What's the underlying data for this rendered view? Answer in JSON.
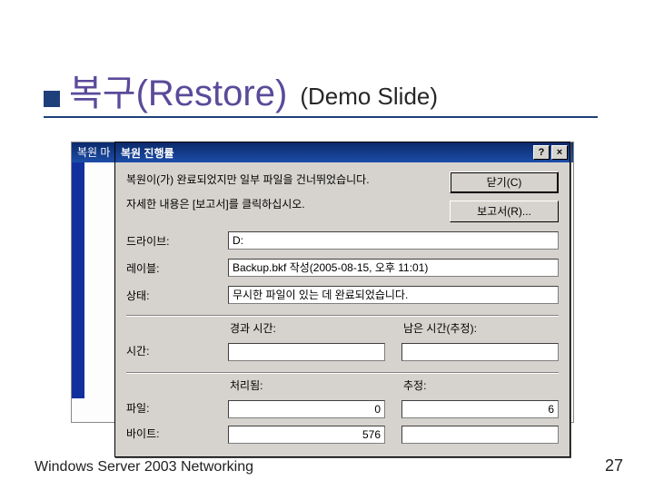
{
  "slide": {
    "title_main": "복구(Restore)",
    "title_sub": "(Demo Slide)",
    "footer_left": "Windows Server 2003 Networking",
    "page_number": "27"
  },
  "back_window": {
    "title": "복원 마"
  },
  "dialog": {
    "title": "복원 진행률",
    "help_btn": "?",
    "close_btn": "×",
    "msg1": "복원이(가) 완료되었지만 일부 파일을 건너뛰었습니다.",
    "msg2": "자세한 내용은 [보고서]를 클릭하십시오.",
    "btn_close": "닫기(C)",
    "btn_report": "보고서(R)...",
    "labels": {
      "drive": "드라이브:",
      "label": "레이블:",
      "status": "상태:",
      "time": "시간:",
      "files": "파일:",
      "bytes": "바이트:",
      "elapsed": "경과 시간:",
      "remaining": "남은 시간(추정):",
      "processed": "처리됨:",
      "estimated": "추정:"
    },
    "values": {
      "drive": "D:",
      "label": "Backup.bkf 작성(2005-08-15, 오후 11:01)",
      "status": "무시한 파일이 있는 데 완료되었습니다.",
      "elapsed_time": "",
      "remaining_time": "",
      "files_processed": "0",
      "files_estimated": "6",
      "bytes_processed": "576",
      "bytes_estimated": ""
    }
  }
}
